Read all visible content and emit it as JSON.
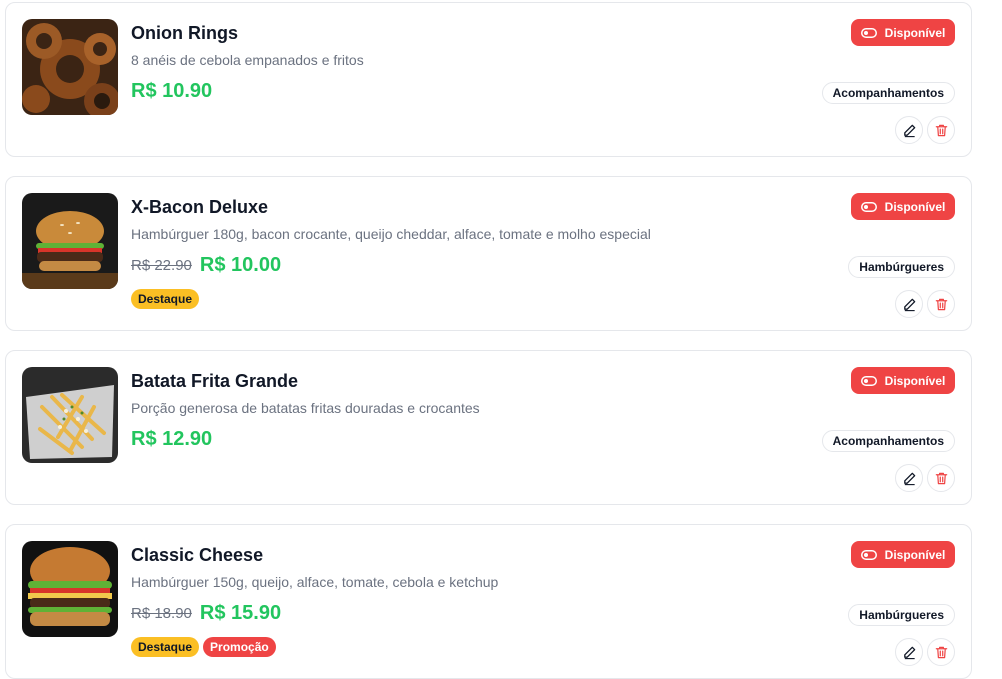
{
  "currency": "R$",
  "colors": {
    "available": "#ef4444",
    "price": "#22c55e",
    "featured_badge": "#fbbf24",
    "promo_badge": "#ef4444"
  },
  "products": [
    {
      "name": "Onion Rings",
      "description": "8 anéis de cebola empanados e fritos",
      "old_price": "",
      "price": "R$ 10.90",
      "status": "Disponível",
      "category": "Acompanhamentos",
      "image_icon": "onion-rings-image",
      "badges": []
    },
    {
      "name": "X-Bacon Deluxe",
      "description": "Hambúrguer 180g, bacon crocante, queijo cheddar, alface, tomate e molho especial",
      "old_price": "R$ 22.90",
      "price": "R$ 10.00",
      "status": "Disponível",
      "category": "Hambúrgueres",
      "image_icon": "burger-image",
      "badges": [
        {
          "label": "Destaque",
          "kind": "featured"
        }
      ]
    },
    {
      "name": "Batata Frita Grande",
      "description": "Porção generosa de batatas fritas douradas e crocantes",
      "old_price": "",
      "price": "R$ 12.90",
      "status": "Disponível",
      "category": "Acompanhamentos",
      "image_icon": "fries-image",
      "badges": []
    },
    {
      "name": "Classic Cheese",
      "description": "Hambúrguer 150g, queijo, alface, tomate, cebola e ketchup",
      "old_price": "R$ 18.90",
      "price": "R$ 15.90",
      "status": "Disponível",
      "category": "Hambúrgueres",
      "image_icon": "burger-image",
      "badges": [
        {
          "label": "Destaque",
          "kind": "featured"
        },
        {
          "label": "Promoção",
          "kind": "promo"
        }
      ]
    }
  ]
}
